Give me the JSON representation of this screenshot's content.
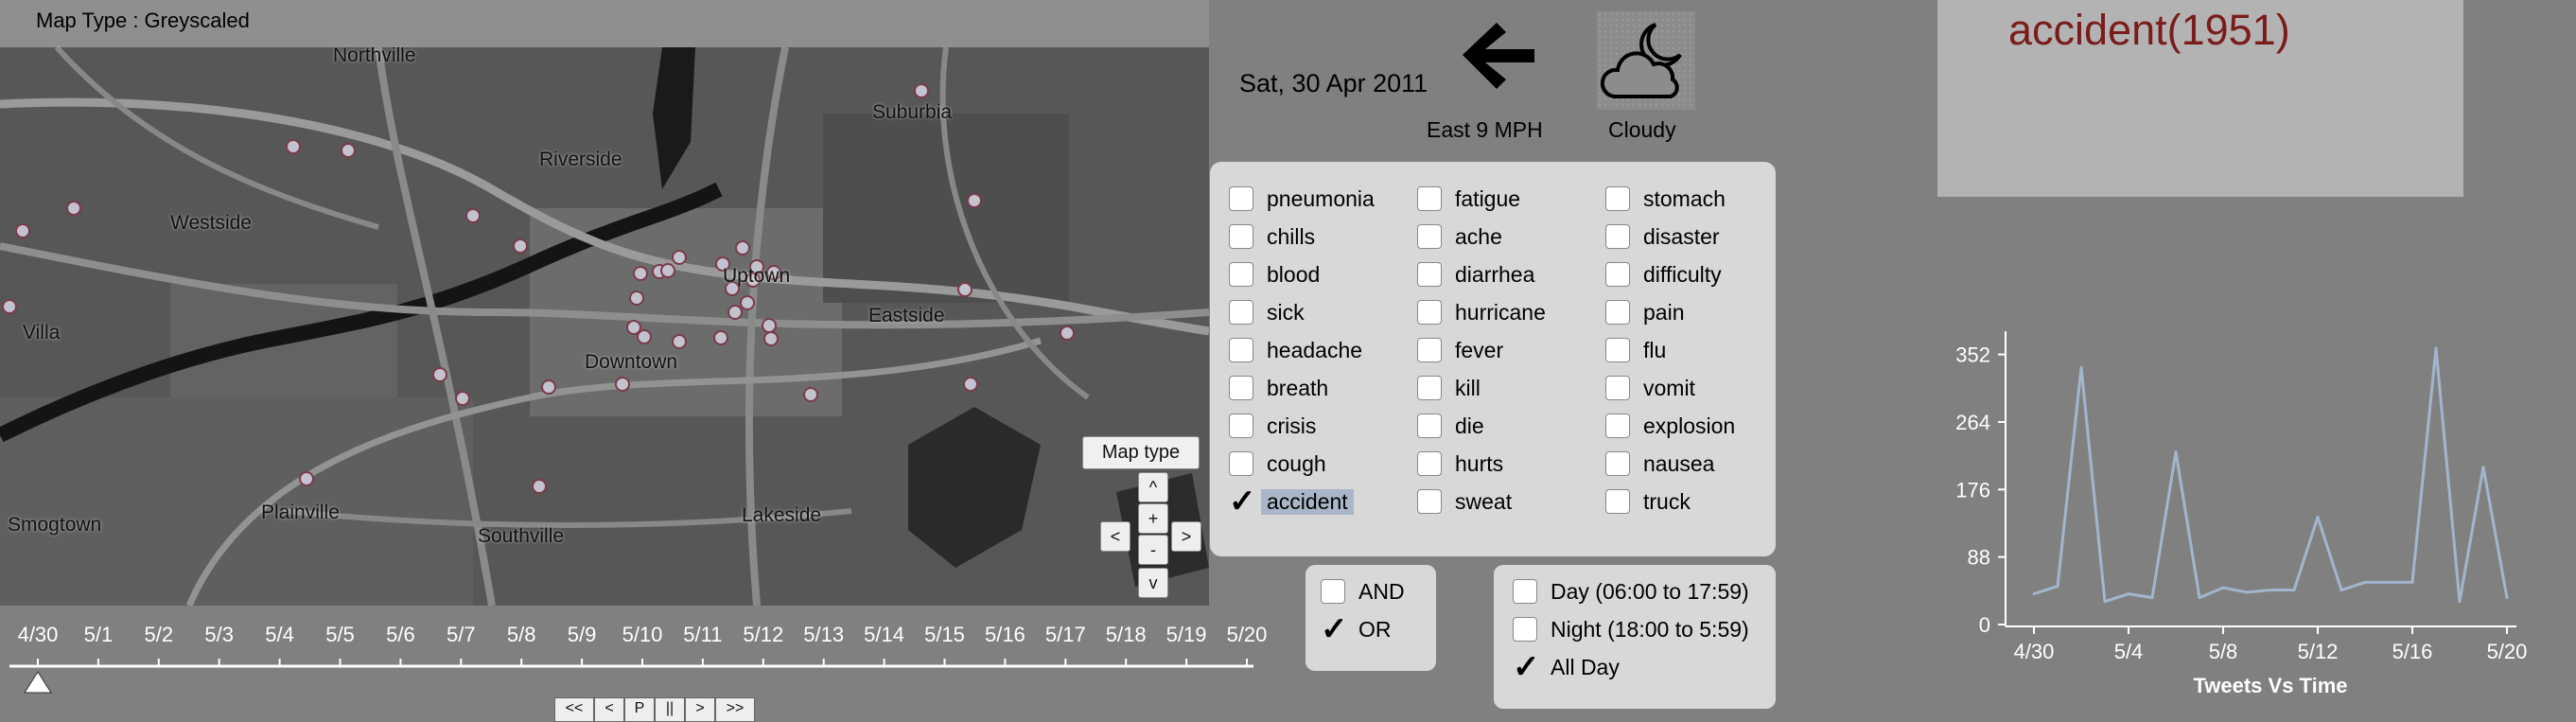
{
  "map": {
    "type_label": "Map Type : Greyscaled",
    "maptype_button": "Map type",
    "places": [
      {
        "name": "Northville"
      },
      {
        "name": "Suburbia"
      },
      {
        "name": "Riverside"
      },
      {
        "name": "Westside"
      },
      {
        "name": "Uptown"
      },
      {
        "name": "Eastside"
      },
      {
        "name": "Villa"
      },
      {
        "name": "Downtown"
      },
      {
        "name": "Plainville"
      },
      {
        "name": "Southville"
      },
      {
        "name": "Lakeside"
      },
      {
        "name": "Smogtown"
      }
    ],
    "nav": {
      "up": "^",
      "plus": "+",
      "minus": "-",
      "left": "<",
      "right": ">",
      "down": "v"
    }
  },
  "timeline": {
    "ticks": [
      "4/30",
      "5/1",
      "5/2",
      "5/3",
      "5/4",
      "5/5",
      "5/6",
      "5/7",
      "5/8",
      "5/9",
      "5/10",
      "5/11",
      "5/12",
      "5/13",
      "5/14",
      "5/15",
      "5/16",
      "5/17",
      "5/18",
      "5/19",
      "5/20"
    ],
    "slider_value": "4/30",
    "buttons": [
      "<<",
      "<",
      "P",
      "||",
      ">",
      ">>"
    ]
  },
  "header": {
    "date": "Sat, 30 Apr 2011",
    "wind": "East 9 MPH",
    "weather": "Cloudy",
    "wind_icon": "left-arrow-icon",
    "weather_icon": "cloud-moon-icon"
  },
  "keywords": {
    "columns": [
      [
        "pneumonia",
        "chills",
        "blood",
        "sick",
        "headache",
        "breath",
        "crisis",
        "cough",
        "accident"
      ],
      [
        "fatigue",
        "ache",
        "diarrhea",
        "hurricane",
        "fever",
        "kill",
        "die",
        "hurts",
        "sweat"
      ],
      [
        "stomach",
        "disaster",
        "difficulty",
        "pain",
        "flu",
        "vomit",
        "explosion",
        "nausea",
        "truck"
      ]
    ],
    "checked": [
      "accident"
    ]
  },
  "logic": {
    "options": [
      "AND",
      "OR"
    ],
    "selected": "OR"
  },
  "time_filter": {
    "options": [
      "Day (06:00 to 17:59)",
      "Night (18:00 to 5:59)",
      "All Day"
    ],
    "selected": "All Day"
  },
  "selected_keyword": {
    "title": "accident(1951)",
    "color": "#7a1c1c"
  },
  "chart_data": {
    "type": "line",
    "title": "Tweets Vs Time",
    "xlabel": "Tweets Vs Time",
    "ylabel": "",
    "x_ticks": [
      "4/30",
      "5/4",
      "5/8",
      "5/12",
      "5/16",
      "5/20"
    ],
    "y_ticks": [
      0,
      88,
      176,
      264,
      352
    ],
    "ylim": [
      0,
      370
    ],
    "x": [
      "4/30",
      "5/1",
      "5/2",
      "5/3",
      "5/4",
      "5/5",
      "5/6",
      "5/7",
      "5/8",
      "5/9",
      "5/10",
      "5/11",
      "5/12",
      "5/13",
      "5/14",
      "5/15",
      "5/16",
      "5/17",
      "5/18",
      "5/19",
      "5/20"
    ],
    "series": [
      {
        "values": [
          40,
          50,
          335,
          30,
          40,
          35,
          225,
          35,
          48,
          42,
          45,
          45,
          140,
          45,
          55,
          55,
          55,
          360,
          30,
          205,
          35
        ],
        "color": "#a3b5cc"
      }
    ]
  }
}
